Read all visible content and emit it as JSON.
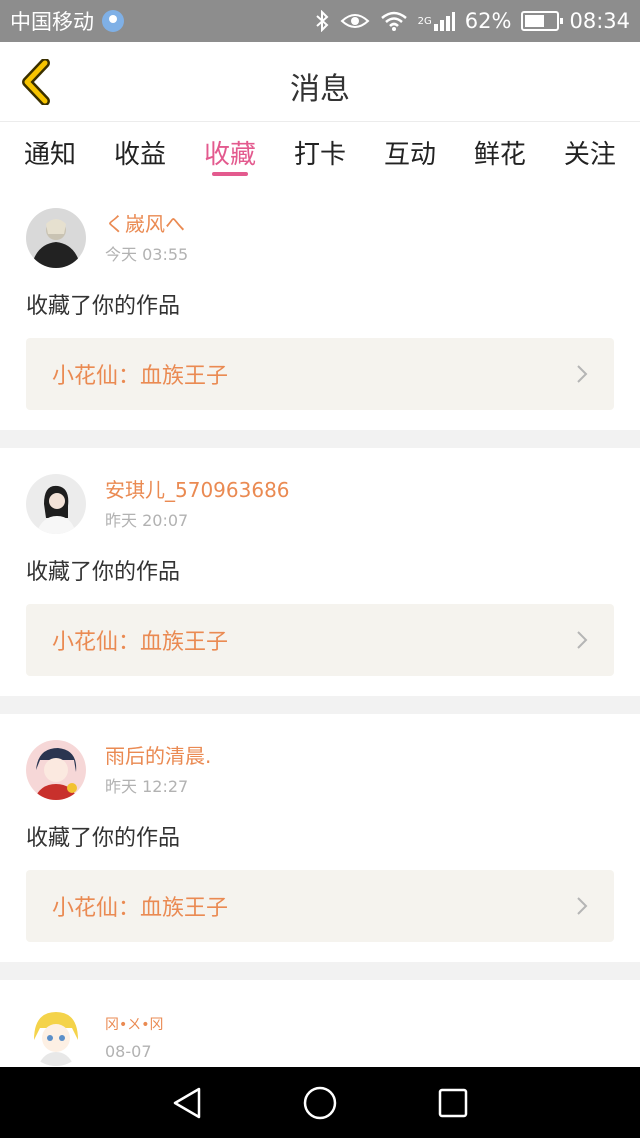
{
  "status_bar": {
    "carrier": "中国移动",
    "battery_percent": "62%",
    "battery_level": 0.62,
    "network_label": "2G",
    "time": "08:34"
  },
  "header": {
    "title": "消息",
    "back_icon": "chevron-left-icon"
  },
  "tabs": [
    {
      "label": "通知",
      "active": false
    },
    {
      "label": "收益",
      "active": false
    },
    {
      "label": "收藏",
      "active": true
    },
    {
      "label": "打卡",
      "active": false
    },
    {
      "label": "互动",
      "active": false
    },
    {
      "label": "鲜花",
      "active": false
    },
    {
      "label": "关注",
      "active": false
    }
  ],
  "feed": {
    "items": [
      {
        "user": "く嵗风へ",
        "time": "今天 03:55",
        "action": "收藏了你的作品",
        "work": "小花仙：血族王子"
      },
      {
        "user": "安琪儿_570963686",
        "time": "昨天 20:07",
        "action": "收藏了你的作品",
        "work": "小花仙：血族王子"
      },
      {
        "user": "雨后的清晨.",
        "time": "昨天 12:27",
        "action": "收藏了你的作品",
        "work": "小花仙：血族王子"
      },
      {
        "user": "冈•ㄨ•冈",
        "time": "08-07",
        "action": "",
        "work": ""
      }
    ]
  },
  "colors": {
    "accent": "#e35a8e",
    "username": "#ea8a52",
    "link_bg": "#f5f3ee",
    "status_bar_bg": "#8d8d8d"
  }
}
